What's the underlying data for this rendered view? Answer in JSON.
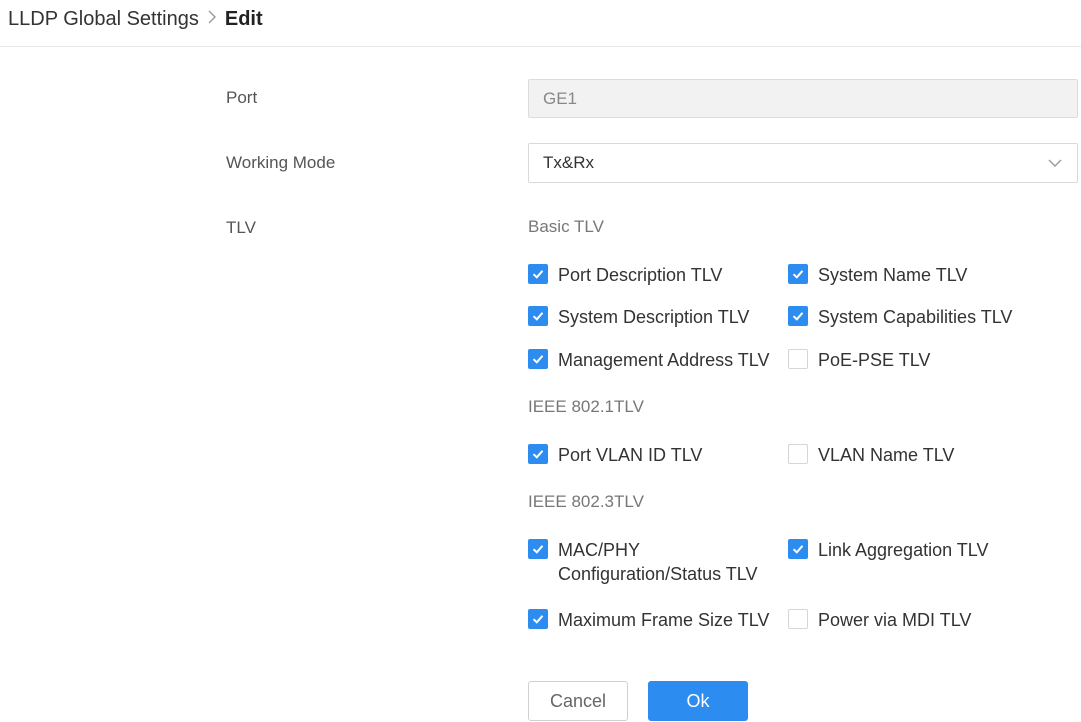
{
  "breadcrumb": {
    "parent": "LLDP Global Settings",
    "separator": ">",
    "current": "Edit"
  },
  "form": {
    "port_label": "Port",
    "port_value": "GE1",
    "mode_label": "Working Mode",
    "mode_value": "Tx&Rx",
    "tlv_label": "TLV"
  },
  "sections": {
    "basic": "Basic TLV",
    "ieee8021": "IEEE 802.1TLV",
    "ieee8023": "IEEE 802.3TLV"
  },
  "checkboxes": {
    "port_description": {
      "label": "Port Description TLV",
      "checked": true
    },
    "system_name": {
      "label": "System Name TLV",
      "checked": true
    },
    "system_description": {
      "label": "System Description TLV",
      "checked": true
    },
    "system_capabilities": {
      "label": "System Capabilities TLV",
      "checked": true
    },
    "management_address": {
      "label": "Management Address TLV",
      "checked": true
    },
    "poe_pse": {
      "label": "PoE-PSE TLV",
      "checked": false
    },
    "port_vlan_id": {
      "label": "Port VLAN ID TLV",
      "checked": true
    },
    "vlan_name": {
      "label": "VLAN Name TLV",
      "checked": false
    },
    "mac_phy_line1": {
      "label": "MAC/PHY",
      "checked": true
    },
    "mac_phy_line2": "Configuration/Status TLV",
    "link_aggregation": {
      "label": "Link Aggregation TLV",
      "checked": true
    },
    "max_frame_size": {
      "label": "Maximum Frame Size TLV",
      "checked": true
    },
    "power_via_mdi": {
      "label": "Power via MDI TLV",
      "checked": false
    }
  },
  "buttons": {
    "cancel": "Cancel",
    "ok": "Ok"
  },
  "colors": {
    "accent": "#2d8cf0",
    "field_disabled_bg": "#f2f2f2"
  }
}
